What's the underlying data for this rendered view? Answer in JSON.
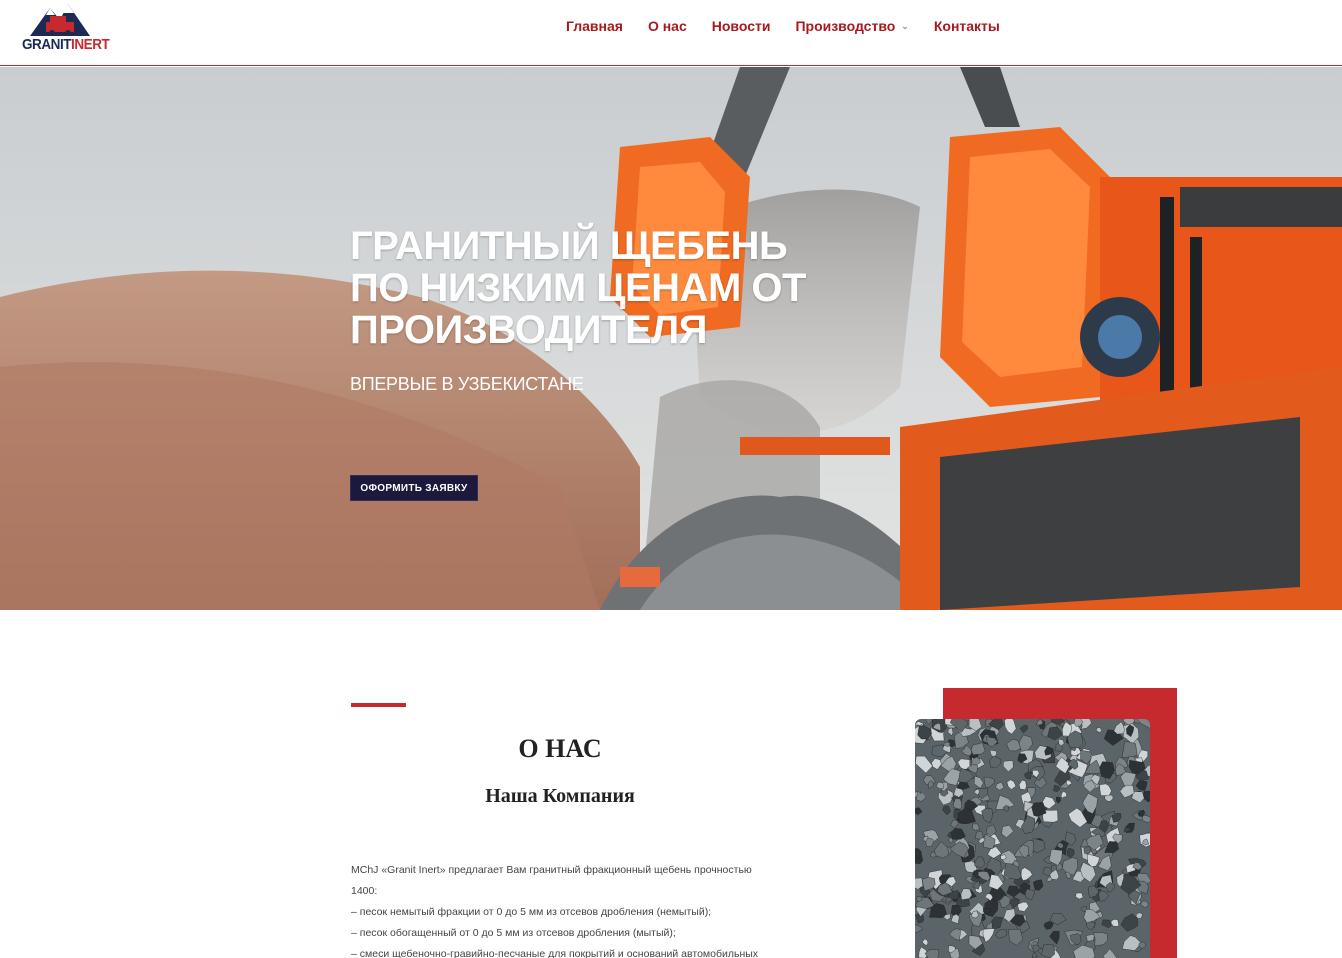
{
  "header": {
    "logo_text_primary": "GRANIT",
    "logo_text_accent": "INERT",
    "nav": [
      {
        "label": "Главная"
      },
      {
        "label": "О нас"
      },
      {
        "label": "Новости"
      },
      {
        "label": "Производство",
        "has_dropdown": true
      },
      {
        "label": "Контакты"
      }
    ]
  },
  "hero": {
    "title": "Гранитный щебень по низким ценам от производителя",
    "subtitle": "ВПЕРВЫЕ В УЗБЕКИСТАНЕ",
    "button_label": "ОФОРМИТЬ ЗАЯВКУ"
  },
  "about": {
    "title": "О НАС",
    "subtitle": "Наша Компания",
    "paragraphs": [
      "MChJ «Granit Inert» предлагает Вам гранитный фракционный щебень прочностью 1400:",
      "– песок немытый фракции от 0 до 5 мм из отсевов дробления (немытый);",
      "– песок обогащенный от 0 до 5 мм из отсевов дробления (мытый);",
      "– смеси щебеночно-гравийно-песчаные для покрытий и оснований автомобильных"
    ]
  },
  "colors": {
    "brand_red": "#c62a2f",
    "nav_red": "#a8191f",
    "brand_navy": "#1d2a54",
    "button_bg": "#1b1a3d"
  }
}
